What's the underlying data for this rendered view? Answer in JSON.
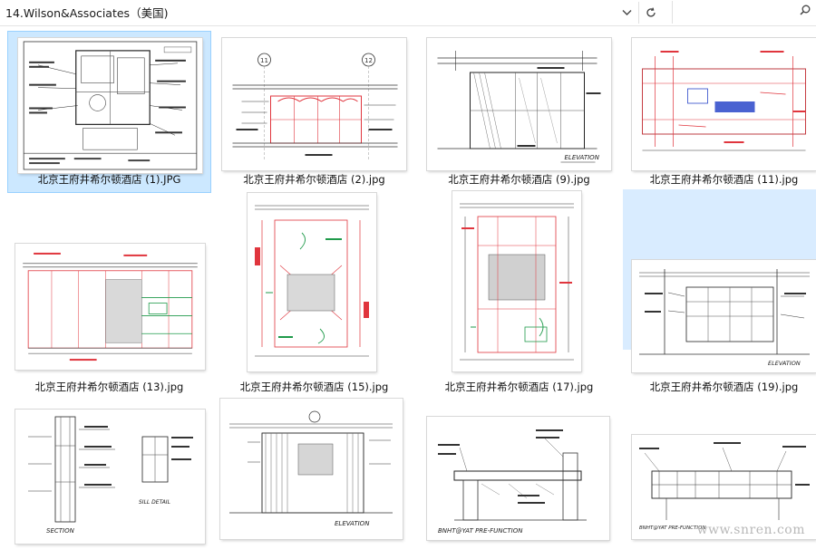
{
  "window": {
    "path": "14.Wilson&Associates（美国)",
    "dropdown_icon": "chevron-down-icon",
    "refresh_icon": "refresh-icon",
    "search_icon": "search-icon"
  },
  "files": [
    {
      "name": "北京王府井希尔顿酒店 (1).JPG"
    },
    {
      "name": "北京王府井希尔顿酒店 (2).jpg"
    },
    {
      "name": "北京王府井希尔顿酒店 (9).jpg"
    },
    {
      "name": "北京王府井希尔顿酒店 (11).jpg"
    },
    {
      "name": "北京王府井希尔顿酒店 (13).jpg"
    },
    {
      "name": "北京王府井希尔顿酒店 (15).jpg"
    },
    {
      "name": "北京王府井希尔顿酒店 (17).jpg"
    },
    {
      "name": "北京王府井希尔顿酒店 (19).jpg"
    },
    {
      "name": ""
    },
    {
      "name": ""
    },
    {
      "name": ""
    },
    {
      "name": ""
    }
  ],
  "drawing_labels": {
    "grid_11": "11",
    "grid_12": "12",
    "elevation": "ELEVATION",
    "section": "SECTION",
    "detail": "SILL DETAIL",
    "pre_function": "BNHT@YAT PRE-FUNCTION"
  },
  "watermark": "www.snren.com",
  "colors": {
    "selected_bg": "#cce8ff",
    "hover_bg": "#d9ecff",
    "redline": "#e0353d",
    "greenline": "#1f9a4a",
    "blueline": "#2a46c9"
  }
}
